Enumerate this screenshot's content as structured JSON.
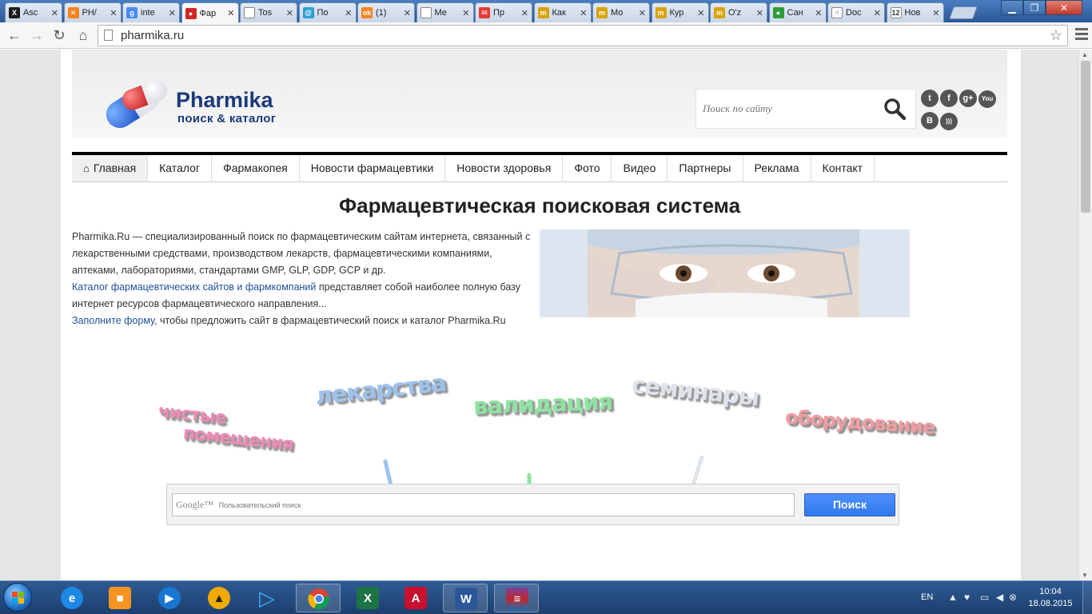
{
  "browser": {
    "tabs": [
      {
        "label": "Asc",
        "icon": "joomla-icon",
        "color": "#1a1a1a",
        "glyph": "X"
      },
      {
        "label": "PH/",
        "icon": "joomla-icon",
        "color": "#f58220",
        "glyph": "✕"
      },
      {
        "label": "inte",
        "icon": "google-plus-icon",
        "color": "#4a8af4",
        "glyph": "g"
      },
      {
        "label": "Фар",
        "icon": "pills-icon",
        "color": "#d02626",
        "glyph": "●",
        "active": true
      },
      {
        "label": "Tos",
        "icon": "page-icon",
        "color": "#ffffff",
        "glyph": ""
      },
      {
        "label": "По",
        "icon": "mail-icon",
        "color": "#2a9fd6",
        "glyph": "@"
      },
      {
        "label": "(1)",
        "icon": "odnoklassniki-icon",
        "color": "#f58220",
        "glyph": "ok"
      },
      {
        "label": "Ме",
        "icon": "page-icon",
        "color": "#ffffff",
        "glyph": ""
      },
      {
        "label": "Пр",
        "icon": "mail-red-icon",
        "color": "#e53935",
        "glyph": "✉"
      },
      {
        "label": "Как",
        "icon": "mm-icon",
        "color": "#d9a300",
        "glyph": "m"
      },
      {
        "label": "Мо",
        "icon": "mm-icon",
        "color": "#d9a300",
        "glyph": "m"
      },
      {
        "label": "Кур",
        "icon": "mm-icon",
        "color": "#d9a300",
        "glyph": "m"
      },
      {
        "label": "O'z",
        "icon": "cap-icon",
        "color": "#d9a300",
        "glyph": "m"
      },
      {
        "label": "Сан",
        "icon": "green-icon",
        "color": "#2e9e3a",
        "glyph": "●"
      },
      {
        "label": "Doc",
        "icon": "hand-icon",
        "color": "#ffffff",
        "glyph": "☝"
      },
      {
        "label": "Нов",
        "icon": "news-12-icon",
        "color": "#ffffff",
        "glyph": "12"
      }
    ],
    "address": "pharmika.ru"
  },
  "site": {
    "logo_title": "Pharmika",
    "logo_subtitle": "поиск & каталог",
    "search_placeholder": "Поиск по сайту",
    "social": [
      {
        "name": "twitter-icon",
        "glyph": "t"
      },
      {
        "name": "facebook-icon",
        "glyph": "f"
      },
      {
        "name": "google-plus-icon",
        "glyph": "g+"
      },
      {
        "name": "youtube-icon",
        "glyph": "You"
      },
      {
        "name": "vk-icon",
        "glyph": "B"
      },
      {
        "name": "rss-icon",
        "glyph": ")))"
      }
    ],
    "nav": [
      "Главная",
      "Каталог",
      "Фармакопея",
      "Новости фармацевтики",
      "Новости здоровья",
      "Фото",
      "Видео",
      "Партнеры",
      "Реклама",
      "Контакт"
    ],
    "page_title": "Фармацевтическая поисковая система",
    "intro_text_1": "Pharmika.Ru — специализированный поиск по фармацевтическим сайтам интернета, связанный с лекарственными средствами, производством лекарств, фармацевтическими компаниями, аптеками, лабораториями, стандартами GMP, GLP, GDP, GCP и др.",
    "intro_link_1": "Каталог фармацевтических сайтов и фармкомпаний",
    "intro_text_2": " представляет собой наиболее полную базу интернет ресурсов фармацевтического направления...",
    "intro_link_2": "Заполните форму",
    "intro_text_3": ", чтобы предложить сайт в фармацевтический поиск и каталог Pharmika.Ru",
    "tags": [
      {
        "text": "чистые помещения",
        "color": "#f08ab6"
      },
      {
        "text": "лекарства",
        "color": "#9cc3f0"
      },
      {
        "text": "валидация",
        "color": "#8fe3a0"
      },
      {
        "text": "семинары",
        "color": "#dfe4ea"
      },
      {
        "text": "оборудование",
        "color": "#f39ca0"
      }
    ],
    "google_placeholder": "Пользовательский поиск",
    "google_brand": "Google™",
    "google_button": "Поиск"
  },
  "taskbar": {
    "language": "EN",
    "time": "10:04",
    "date": "18.08.2015"
  }
}
